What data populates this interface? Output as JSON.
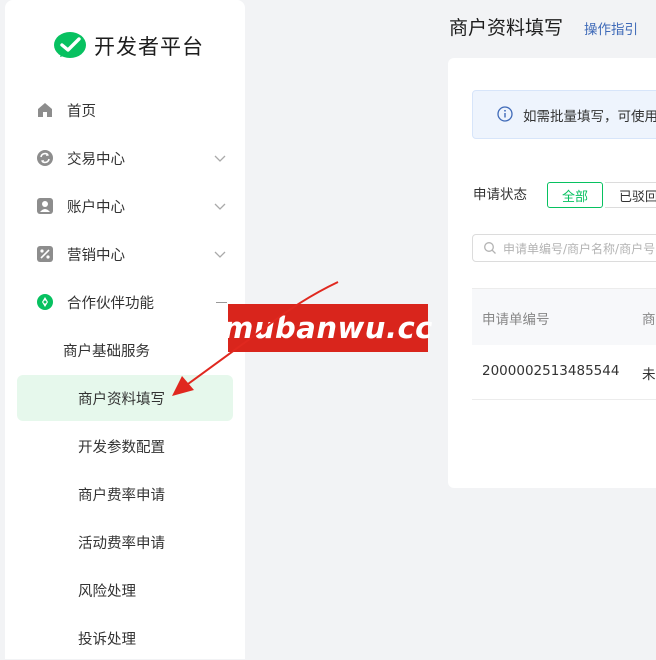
{
  "brand": {
    "name": "开发者平台",
    "color": "#07c160"
  },
  "sidebar": {
    "items": [
      {
        "label": "首页",
        "icon": "home-icon"
      },
      {
        "label": "交易中心",
        "icon": "exchange-icon"
      },
      {
        "label": "账户中心",
        "icon": "account-icon"
      },
      {
        "label": "营销中心",
        "icon": "discount-icon"
      },
      {
        "label": "合作伙伴功能",
        "icon": "partner-icon"
      }
    ],
    "group": {
      "label": "商户基础服务"
    },
    "leaves": [
      {
        "label": "商户资料填写",
        "active": true
      },
      {
        "label": "开发参数配置"
      },
      {
        "label": "商户费率申请"
      },
      {
        "label": "活动费率申请"
      },
      {
        "label": "风险处理"
      },
      {
        "label": "投诉处理"
      }
    ]
  },
  "header": {
    "title": "商户资料填写",
    "guide_link": "操作指引"
  },
  "notice": {
    "text": "如需批量填写，可使用"
  },
  "filter": {
    "status_label": "申请状态",
    "options": [
      {
        "label": "全部",
        "selected": true
      },
      {
        "label": "已驳回"
      }
    ]
  },
  "search": {
    "placeholder": "申请单编号/商户名称/商户号"
  },
  "table": {
    "columns": [
      "申请单编号",
      "商"
    ],
    "rows": [
      [
        "2000002513485544",
        "未"
      ]
    ]
  },
  "watermark": {
    "text": "mubanwu.cc"
  },
  "colors": {
    "accent": "#07c160",
    "link": "#3f6ab8",
    "watermark_bg": "#d9251c",
    "active_bg": "#e6f8ec"
  }
}
